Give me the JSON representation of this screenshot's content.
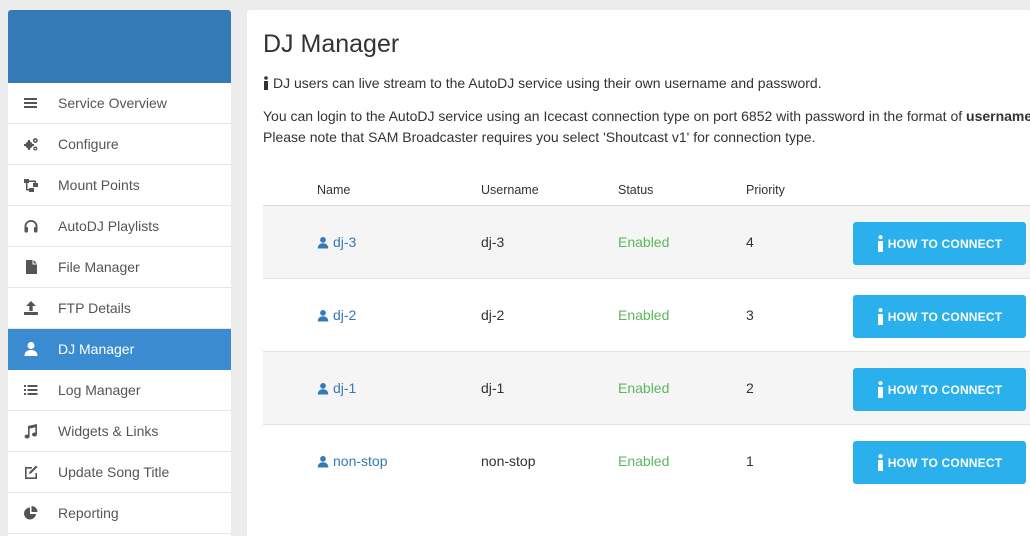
{
  "sidebar": {
    "items": [
      {
        "label": "Service Overview",
        "icon": "menu-bars-icon",
        "active": false
      },
      {
        "label": "Configure",
        "icon": "gears-icon",
        "active": false
      },
      {
        "label": "Mount Points",
        "icon": "sitemap-icon",
        "active": false
      },
      {
        "label": "AutoDJ Playlists",
        "icon": "headphones-icon",
        "active": false
      },
      {
        "label": "File Manager",
        "icon": "file-icon",
        "active": false
      },
      {
        "label": "FTP Details",
        "icon": "upload-icon",
        "active": false
      },
      {
        "label": "DJ Manager",
        "icon": "user-icon",
        "active": true
      },
      {
        "label": "Log Manager",
        "icon": "list-icon",
        "active": false
      },
      {
        "label": "Widgets & Links",
        "icon": "music-note-icon",
        "active": false
      },
      {
        "label": "Update Song Title",
        "icon": "edit-icon",
        "active": false
      },
      {
        "label": "Reporting",
        "icon": "pie-chart-icon",
        "active": false
      }
    ]
  },
  "main": {
    "title": "DJ Manager",
    "info": "DJ users can live stream to the AutoDJ service using their own username and password.",
    "para_line1": "You can login to the AutoDJ service using an Icecast connection type on port 6852 with password in the format of ",
    "para_line1_bold": "username:password",
    "para_line2": "Please note that SAM Broadcaster requires you select 'Shoutcast v1' for connection type."
  },
  "table": {
    "headers": {
      "name": "Name",
      "username": "Username",
      "status": "Status",
      "priority": "Priority"
    },
    "rows": [
      {
        "name": "dj-3",
        "username": "dj-3",
        "status": "Enabled",
        "priority": "4",
        "button": "HOW TO CONNECT"
      },
      {
        "name": "dj-2",
        "username": "dj-2",
        "status": "Enabled",
        "priority": "3",
        "button": "HOW TO CONNECT"
      },
      {
        "name": "dj-1",
        "username": "dj-1",
        "status": "Enabled",
        "priority": "2",
        "button": "HOW TO CONNECT"
      },
      {
        "name": "non-stop",
        "username": "non-stop",
        "status": "Enabled",
        "priority": "1",
        "button": "HOW TO CONNECT"
      }
    ]
  },
  "colors": {
    "accent": "#337ab7",
    "active_nav": "#3a8bd0",
    "button": "#2ab0ec",
    "status_enabled": "#5cb85c"
  }
}
